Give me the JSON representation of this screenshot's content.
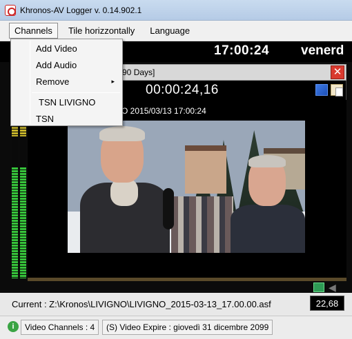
{
  "window": {
    "title": "Khronos-AV Logger  v. 0.14.902.1"
  },
  "menubar": {
    "items": [
      "Channels",
      "Tile horizzontally",
      "Language"
    ]
  },
  "channels_menu": {
    "items": [
      "Add Video",
      "Add Audio",
      "Remove",
      "TSN LIVIGNO",
      "TSN"
    ],
    "submenu_arrow": "▸"
  },
  "clock": {
    "time": "17:00:24",
    "day": "venerd"
  },
  "panel": {
    "title": "g  90 Days]",
    "close_glyph": "✕",
    "timecode": "00:00:24,16",
    "overlay": "O 2015/03/13 17:00:24",
    "progress": 0.0
  },
  "vu": {
    "left_level": 0.72,
    "right_level": 0.72
  },
  "current": {
    "label": "Current : Z:\\Kronos\\LIVIGNO\\LIVIGNO_2015-03-13_17.00.00.asf",
    "counter": "22,68"
  },
  "statusbar": {
    "info_glyph": "i",
    "video_channels": "Video Channels : 4",
    "video_expire": "(S) Video Expire : giovedì 31 dicembre 2099"
  },
  "colors": {
    "close": "#d93a2f",
    "vu": "#36c43a",
    "progress": "#e08a20"
  }
}
